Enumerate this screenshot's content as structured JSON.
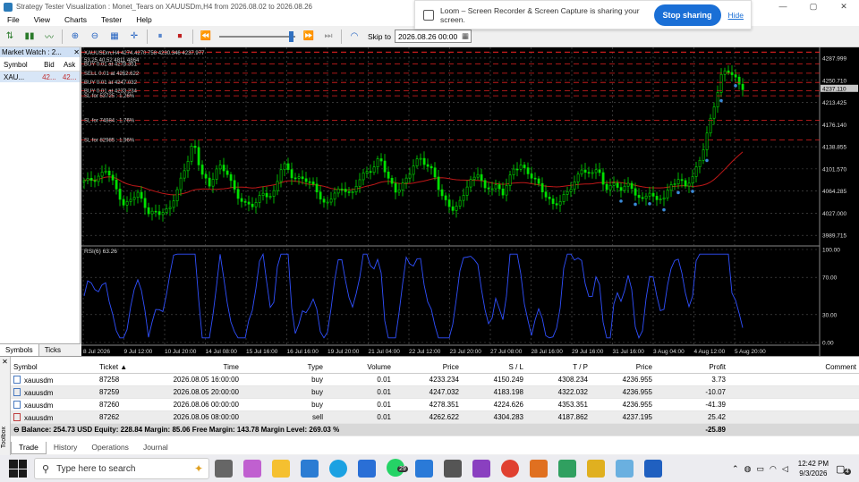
{
  "window": {
    "title": "Strategy Tester Visualization : Monet_Tears on XAUUSDm,H4 from 2026.08.02 to 2026.08.26",
    "controls": [
      "—",
      "▢",
      "✕"
    ]
  },
  "menu": [
    "File",
    "View",
    "Charts",
    "Tester",
    "Help"
  ],
  "loom": {
    "message": "Loom – Screen Recorder & Screen Capture is sharing your screen.",
    "stop_label": "Stop sharing",
    "hide_label": "Hide"
  },
  "toolbar": {
    "skip_label": "Skip to",
    "skip_value": "2026.08.26 00:00"
  },
  "market_watch": {
    "title": "Market Watch : 2...",
    "columns": [
      "Symbol",
      "Bid",
      "Ask"
    ],
    "rows": [
      {
        "symbol": "XAU...",
        "bid": "42...",
        "ask": "42..."
      }
    ],
    "tabs": [
      "Symbols",
      "Ticks"
    ]
  },
  "chart": {
    "header": "XAUUSDm,H4  4274.4270.758 4230.346 4237.977",
    "header2": "53.25 40.52 4811 4864",
    "price_ticks": [
      "4287.999",
      "4250.710",
      "4237.110",
      "4213.425",
      "4176.140",
      "4138.855",
      "4101.570",
      "4064.285",
      "4027.000",
      "3989.715"
    ],
    "current_price": "4237.110",
    "time_ticks": [
      "8 Jul 2026",
      "9 Jul 12:00",
      "10 Jul 20:00",
      "14 Jul 08:00",
      "15 Jul 16:00",
      "16 Jul 16:00",
      "19 Jul 20:00",
      "21 Jul 04:00",
      "22 Jul 12:00",
      "23 Jul 20:00",
      "27 Jul 08:00",
      "28 Jul 16:00",
      "29 Jul 16:00",
      "31 Jul 16:00",
      "3 Aug 04:00",
      "4 Aug 12:00",
      "5 Aug 20:00"
    ],
    "order_labels": [
      "BUY 0.01 at 4278.351",
      "SELL 0.01 at 4262.622",
      "BUY 0.01 at 4247.032",
      "BUY 0.01 at 4233.234",
      "SL for 53725 : 1.26%",
      "SL for 74884 : 1.76%",
      "SL for 82985 : 1.96%"
    ],
    "rsi_label": "RSI(6) 63.26",
    "rsi_ticks": [
      "100.00",
      "70.00",
      "30.00",
      "0.00"
    ],
    "colors": {
      "bull": "#00e000",
      "bear": "#00e000",
      "ma": "#c01818",
      "rsi": "#3050ff",
      "order": "#e02020"
    }
  },
  "trade": {
    "columns": [
      "Symbol",
      "Ticket",
      "Time",
      "Type",
      "Volume",
      "Price",
      "S / L",
      "T / P",
      "Price",
      "Profit",
      "Comment"
    ],
    "rows": [
      {
        "symbol": "xauusdm",
        "ticket": "87258",
        "time": "2026.08.05 16:00:00",
        "type": "buy",
        "volume": "0.01",
        "price": "4233.234",
        "sl": "4150.249",
        "tp": "4308.234",
        "cur": "4236.955",
        "profit": "3.73"
      },
      {
        "symbol": "xauusdm",
        "ticket": "87259",
        "time": "2026.08.05 20:00:00",
        "type": "buy",
        "volume": "0.01",
        "price": "4247.032",
        "sl": "4183.198",
        "tp": "4322.032",
        "cur": "4236.955",
        "profit": "-10.07"
      },
      {
        "symbol": "xauusdm",
        "ticket": "87260",
        "time": "2026.08.06 00:00:00",
        "type": "buy",
        "volume": "0.01",
        "price": "4278.351",
        "sl": "4224.626",
        "tp": "4353.351",
        "cur": "4236.955",
        "profit": "-41.39"
      },
      {
        "symbol": "xauusdm",
        "ticket": "87262",
        "time": "2026.08.06 08:00:00",
        "type": "sell",
        "volume": "0.01",
        "price": "4262.622",
        "sl": "4304.283",
        "tp": "4187.862",
        "cur": "4237.195",
        "profit": "25.42"
      }
    ],
    "balance_line": "Balance: 254.73 USD  Equity: 228.84  Margin: 85.06  Free Margin: 143.78  Margin Level: 269.03 %",
    "total_profit": "-25.89",
    "tabs": [
      "Trade",
      "History",
      "Operations",
      "Journal"
    ],
    "toolbox_label": "Toolbox"
  },
  "taskbar": {
    "search_placeholder": "Type here to search",
    "badge": "29",
    "time": "12:42 PM",
    "date": "9/3/2026",
    "notif": "4"
  }
}
